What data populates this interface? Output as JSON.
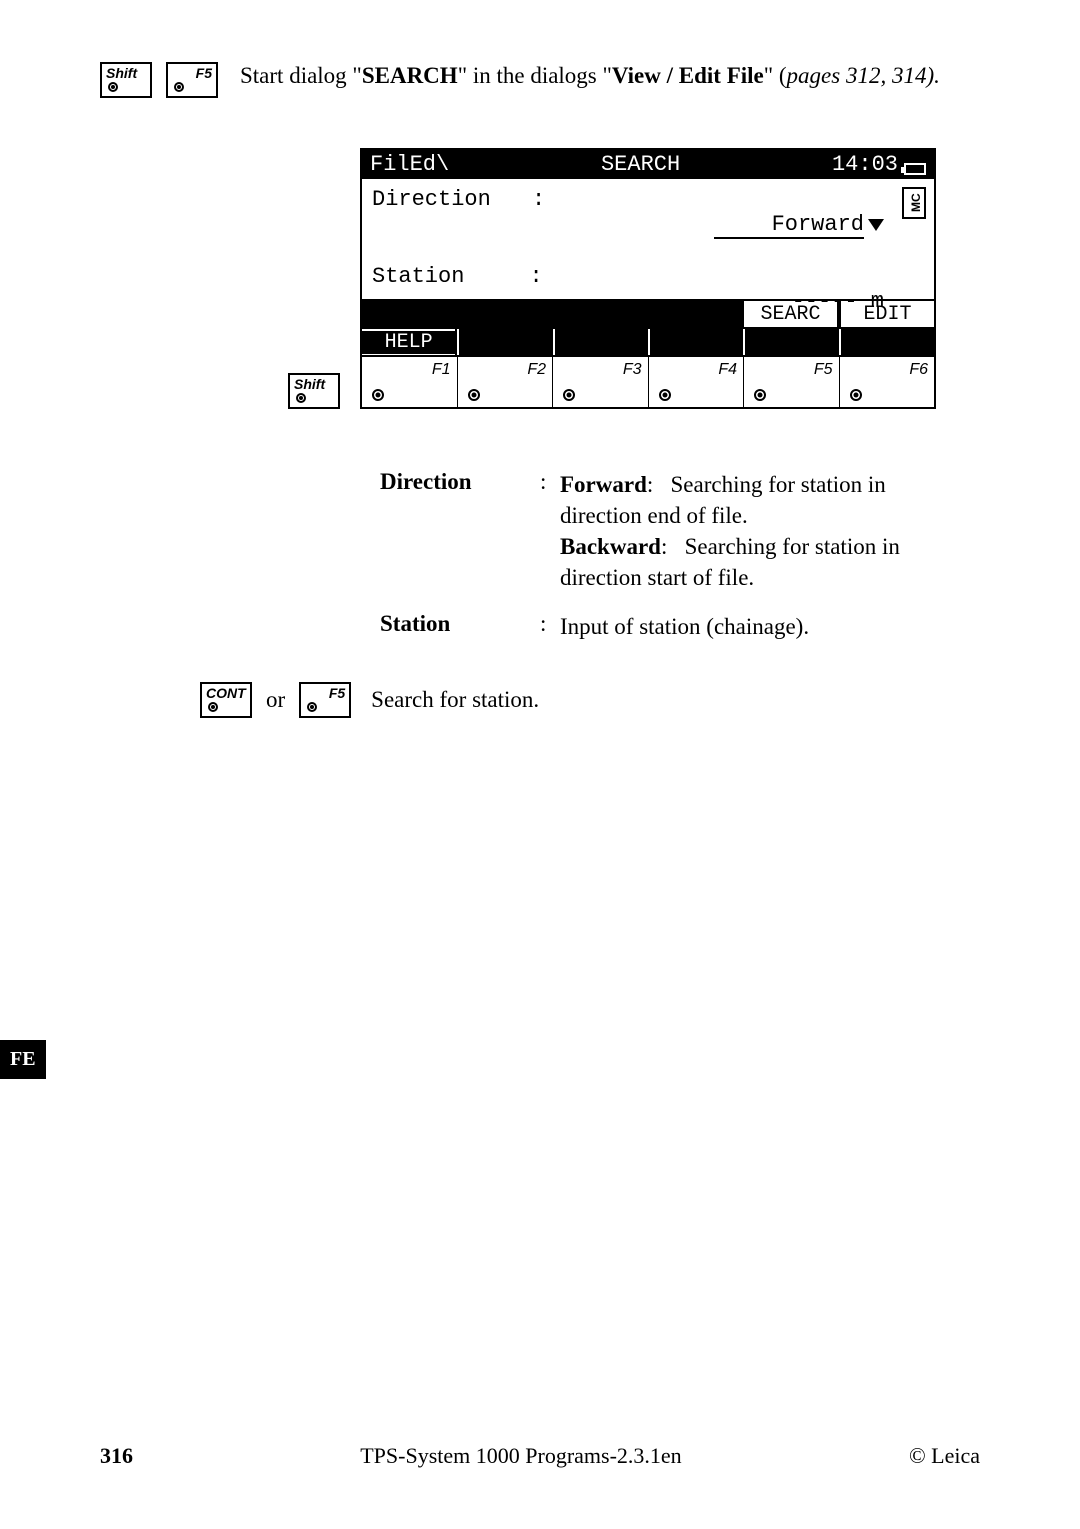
{
  "keys": {
    "shift": "Shift",
    "f5": "F5",
    "cont": "CONT",
    "f1": "F1",
    "f2": "F2",
    "f3": "F3",
    "f4": "F4",
    "f6": "F6"
  },
  "intro": {
    "prefix": "Start dialog \"",
    "bold1": "SEARCH",
    "mid": "\" in the dialogs \"",
    "bold2": "View / Edit File",
    "suffix1": "\" (",
    "italic": "pages 312, 314).",
    "suffix2": ""
  },
  "screen": {
    "title_left": "FilEd\\",
    "title_mid": "SEARCH",
    "title_right": "14:03",
    "rows": {
      "direction_label": "Direction",
      "direction_value": "Forward",
      "station_label": "Station",
      "station_value": "-----",
      "station_unit": "m"
    },
    "mc": "MC",
    "fkeys_row1": [
      "",
      "",
      "",
      "",
      "SEARC",
      "EDIT"
    ],
    "fkeys_row2": [
      "HELP",
      "",
      "",
      "",
      "",
      ""
    ]
  },
  "defs": {
    "direction": {
      "term": "Direction",
      "forward_label": "Forward",
      "forward_text": "Searching for station in direction end of file.",
      "backward_label": "Backward",
      "backward_text": "Searching for station in direction start of file."
    },
    "station": {
      "term": "Station",
      "text": "Input of station (chainage)."
    }
  },
  "action": {
    "or": "or",
    "text": "Search for station."
  },
  "sidetab": "FE",
  "footer": {
    "page": "316",
    "center": "TPS-System 1000 Programs-2.3.1en",
    "right": "© Leica"
  }
}
